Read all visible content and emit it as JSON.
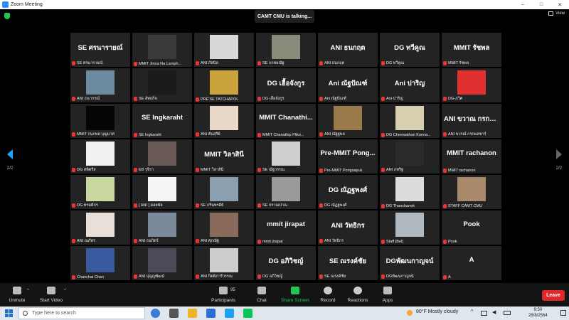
{
  "window": {
    "title": "Zoom Meeting",
    "controls": [
      "–",
      "□",
      "✕"
    ]
  },
  "overlay": {
    "talking": "CAMT CMU is talking...",
    "view_label": "View"
  },
  "paging": {
    "left": "2/2",
    "right": "2/2"
  },
  "tiles": [
    {
      "big": "SE ศรนารายณ์",
      "name": "SE ศรนารายณ์"
    },
    {
      "video": "#3a3a3a",
      "name": "MMIT Jinna Na Lamph..."
    },
    {
      "video": "#d8d8d8",
      "name": "ANI ภัสนิล"
    },
    {
      "video": "#8a8a7a",
      "name": "SE กกชยณัฐ"
    },
    {
      "big": "ANI ธนกฤต",
      "name": "ANI ธนกฤต"
    },
    {
      "big": "DG ทวีคูณ",
      "name": "DG ทวีคูณ"
    },
    {
      "big": "MMIT รัชพล",
      "name": "MMIT รัชพล"
    },
    {
      "video": "#6c8aa0",
      "name": "ANI ธนากรณ์"
    },
    {
      "video": "#1a1a1a",
      "name": "SE อัทธกิจ"
    },
    {
      "video": "#c9a23c",
      "name": "PRE'SE TATCHAPOL"
    },
    {
      "big": "DG เฮื้อจังกูร",
      "name": "DG เฮื้อจังกูร"
    },
    {
      "big": "Ani ณัฐปัณฑ์",
      "name": "Ani ณัฐปัณฑ์"
    },
    {
      "big": "Ani ปาริญ",
      "name": "Ani ปาริญ"
    },
    {
      "video": "#e03030",
      "name": "DG-ภวิศ"
    },
    {
      "video": "#050505",
      "name": "MMIT กนกพล บุญมาศ"
    },
    {
      "big": "SE Ingkaraht",
      "name": "SE Ingkaraht"
    },
    {
      "video": "#e8d8c8",
      "name": "ANI ต้นสุรีย์"
    },
    {
      "big": "MMIT Chanathi...",
      "name": "MMIT Chanathip Pliko..."
    },
    {
      "video": "#9a7a4a",
      "name": "ANI ณัฐฐพล"
    },
    {
      "video": "#d8ceb0",
      "name": "DG Cheewathan Kunna..."
    },
    {
      "big": "ANI ขวาณ กรกม...",
      "name": "ANI ขวรณ์ กรกมลชาร์"
    },
    {
      "video": "#f0f0f0",
      "name": "DG สพิตรีส"
    },
    {
      "video": "#6a5a58",
      "name": "EB รุจิรา"
    },
    {
      "big": "MMIT วิลาสินี",
      "name": "MMIT วิลาสินี"
    },
    {
      "video": "#cfcfcf",
      "name": "SE ณัฐวรรณ"
    },
    {
      "big": "Pre-MMIT Pong...",
      "name": "Pre-MMIT Pongsapuk"
    },
    {
      "video": "#2a2a2a",
      "name": "ANI ภทริฐ"
    },
    {
      "big": "MMIT rachanon",
      "name": "MMIT rachanon"
    },
    {
      "video": "#c8d8a0",
      "name": "DG ทรดติกร"
    },
    {
      "video": "#f5f5f5",
      "name": "[ ANI ] ดอยพัล"
    },
    {
      "video": "#8aa0b0",
      "name": "SE กรินทรดีย์"
    },
    {
      "video": "#9a9a9a",
      "name": "SE ปราณปาณ"
    },
    {
      "big": "DG ณัฏฐพงศ์",
      "name": "DG ณัฏฐพงศ์"
    },
    {
      "video": "#dcdcdc",
      "name": "DG Thanchanok"
    },
    {
      "video": "#a88a6a",
      "name": "STAFF CAMT CMU"
    },
    {
      "video": "#e8e0d8",
      "name": "ANI ณภัทร"
    },
    {
      "video": "#7a8a9a",
      "name": "ANI ธนกิตร์"
    },
    {
      "video": "#8a6a5a",
      "name": "ANI ศุภณัฐ"
    },
    {
      "big": "mmit jirapat",
      "name": "mmit jirapat"
    },
    {
      "big": "ANI วัทธิกร",
      "name": "ANI วัทธิกร"
    },
    {
      "video": "#b0b8c0",
      "name": "Staff [Bel]"
    },
    {
      "big": "Pook",
      "name": "Pook"
    },
    {
      "video": "#3a5aa0",
      "name": "Chanchai Chan"
    },
    {
      "video": "#4a4a58",
      "name": "ANI ปุญญพัฒน์"
    },
    {
      "video": "#cccccc",
      "name": "ANI กิตติภารีวรรณ"
    },
    {
      "big": "DG อภิวิชญ์",
      "name": "DG อภิวิชญ์"
    },
    {
      "big": "SE ณรงค์ชัย",
      "name": "SE ณรงค์ชัย"
    },
    {
      "big": "DGพัฒนกาญจน์",
      "name": "DGพัฒนกาญจน์"
    },
    {
      "big": "A",
      "name": "A"
    }
  ],
  "toolbar": {
    "unmute": "Unmute",
    "start_video": "Start Video",
    "participants": "Participants",
    "participant_count": "95",
    "chat": "Chat",
    "share_screen": "Share Screen",
    "record": "Record",
    "reactions": "Reactions",
    "apps": "Apps",
    "leave": "Leave"
  },
  "taskbar": {
    "search_placeholder": "Type here to search",
    "weather": "80°F  Mostly cloudy",
    "time": "9:50",
    "date": "28/8/2564"
  },
  "colors": {
    "accent_blue": "#1aa3ff",
    "share_green": "#23c552",
    "leave_red": "#e02828",
    "muted_red": "#e33333"
  }
}
